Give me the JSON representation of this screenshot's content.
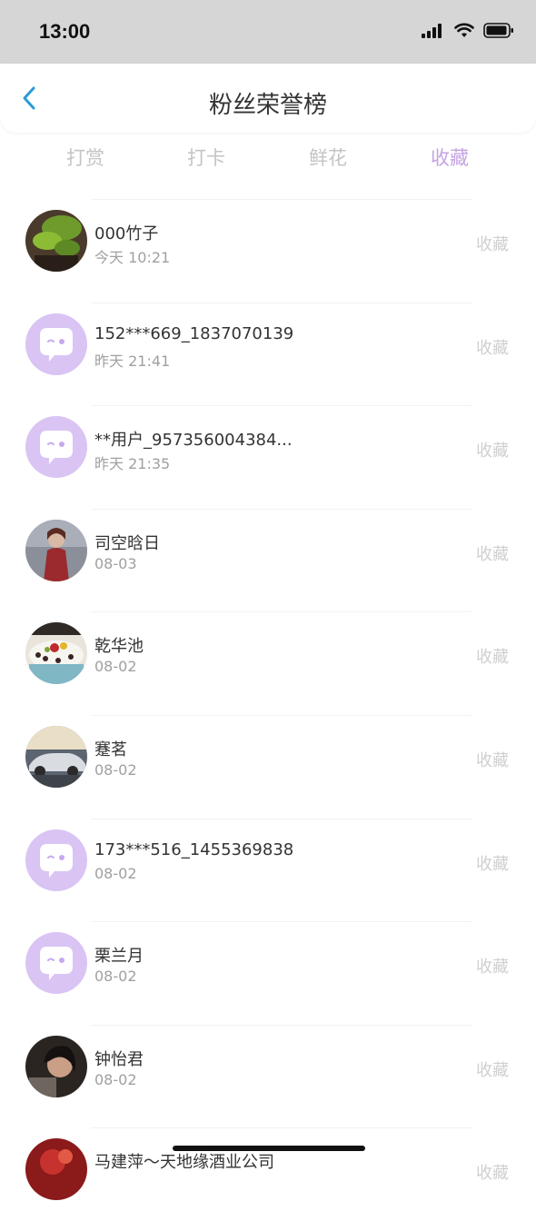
{
  "status": {
    "time": "13:00"
  },
  "nav": {
    "title": "粉丝荣誉榜"
  },
  "tabs": [
    {
      "label": "打赏",
      "active": false
    },
    {
      "label": "打卡",
      "active": false
    },
    {
      "label": "鲜花",
      "active": false
    },
    {
      "label": "收藏",
      "active": true
    }
  ],
  "rows": [
    {
      "name": "000竹子",
      "time": "今天 10:21",
      "action": "收藏",
      "avatar": "plant-photo"
    },
    {
      "name": "152***669_1837070139",
      "time": "昨天 21:41",
      "action": "收藏",
      "avatar": "default-chat"
    },
    {
      "name": "**用户_957356004384...",
      "time": "昨天 21:35",
      "action": "收藏",
      "avatar": "default-chat"
    },
    {
      "name": "司空晗日",
      "time": "08-03",
      "action": "收藏",
      "avatar": "portrait-red"
    },
    {
      "name": "乾华池",
      "time": "08-02",
      "action": "收藏",
      "avatar": "dessert-photo"
    },
    {
      "name": "蹇茗",
      "time": "08-02",
      "action": "收藏",
      "avatar": "car-photo"
    },
    {
      "name": "173***516_1455369838",
      "time": "08-02",
      "action": "收藏",
      "avatar": "default-chat"
    },
    {
      "name": "栗兰月",
      "time": "08-02",
      "action": "收藏",
      "avatar": "default-chat"
    },
    {
      "name": "钟怡君",
      "time": "08-02",
      "action": "收藏",
      "avatar": "portrait-dark"
    },
    {
      "name": "马建萍～天地缘酒业公司",
      "time": "",
      "action": "收藏",
      "avatar": "red-photo"
    }
  ],
  "colors": {
    "accent": "#c6a4e3",
    "back": "#2b9bd8",
    "avatar_default": "#d9c4f4"
  }
}
